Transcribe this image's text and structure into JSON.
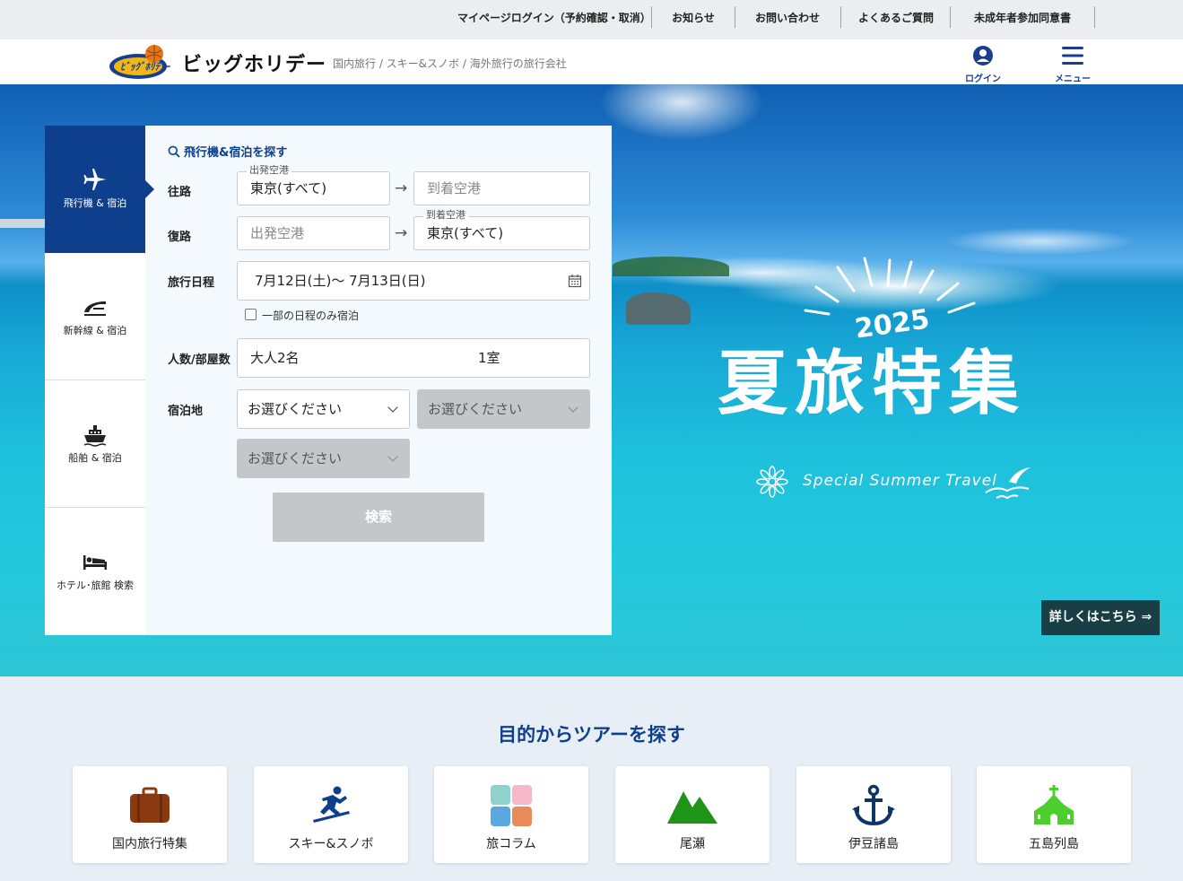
{
  "topbar": {
    "links": [
      {
        "label": "マイページログイン（予約確認・取消）"
      },
      {
        "label": "お知らせ"
      },
      {
        "label": "お問い合わせ"
      },
      {
        "label": "よくあるご質問"
      },
      {
        "label": "未成年者参加同意書"
      }
    ]
  },
  "header": {
    "logo_text": "ビッグホリデー",
    "tagline": "国内旅行 / スキー&スノボ / 海外旅行の旅行会社",
    "login_label": "ログイン",
    "menu_label": "メニュー"
  },
  "hero": {
    "year": "2025",
    "title": "夏旅特集",
    "subtitle": "Special Summer Travel",
    "more_button": "詳しくはこちら ⇒"
  },
  "search": {
    "tabs": [
      {
        "label": "飛行機 & 宿泊",
        "icon": "airplane-icon",
        "active": true
      },
      {
        "label": "新幹線 & 宿泊",
        "icon": "shinkansen-icon",
        "active": false
      },
      {
        "label": "船舶 & 宿泊",
        "icon": "ship-icon",
        "active": false
      },
      {
        "label": "ホテル･旅館 検索",
        "icon": "bed-icon",
        "active": false
      }
    ],
    "title": "飛行機&宿泊を探す",
    "outbound": {
      "label": "往路",
      "from_label": "出発空港",
      "from_value": "東京(すべて)",
      "to_placeholder": "到着空港"
    },
    "return": {
      "label": "復路",
      "from_placeholder": "出発空港",
      "to_label": "到着空港",
      "to_value": "東京(すべて)"
    },
    "dates": {
      "label": "旅行日程",
      "value": "7月12日(土)～  7月13日(日)",
      "partial_stay_label": "一部の日程のみ宿泊",
      "partial_stay_checked": false
    },
    "people": {
      "label": "人数/部屋数",
      "adults": "大人2名",
      "rooms": "1室"
    },
    "destination": {
      "label": "宿泊地",
      "select1": "お選びください",
      "select2": "お選びください",
      "select3": "お選びください"
    },
    "submit_label": "検索"
  },
  "purpose": {
    "title": "目的からツアーを探す",
    "cards": [
      {
        "label": "国内旅行特集",
        "icon": "suitcase-icon"
      },
      {
        "label": "スキー&スノボ",
        "icon": "snowboarder-icon"
      },
      {
        "label": "旅コラム",
        "icon": "tiles-icon"
      },
      {
        "label": "尾瀬",
        "icon": "mountain-icon"
      },
      {
        "label": "伊豆諸島",
        "icon": "anchor-icon"
      },
      {
        "label": "五島列島",
        "icon": "church-icon"
      }
    ]
  },
  "colors": {
    "brand_navy": "#0e3f8d",
    "disabled_gray": "#c4c6c9",
    "button_dark": "#173f45"
  }
}
